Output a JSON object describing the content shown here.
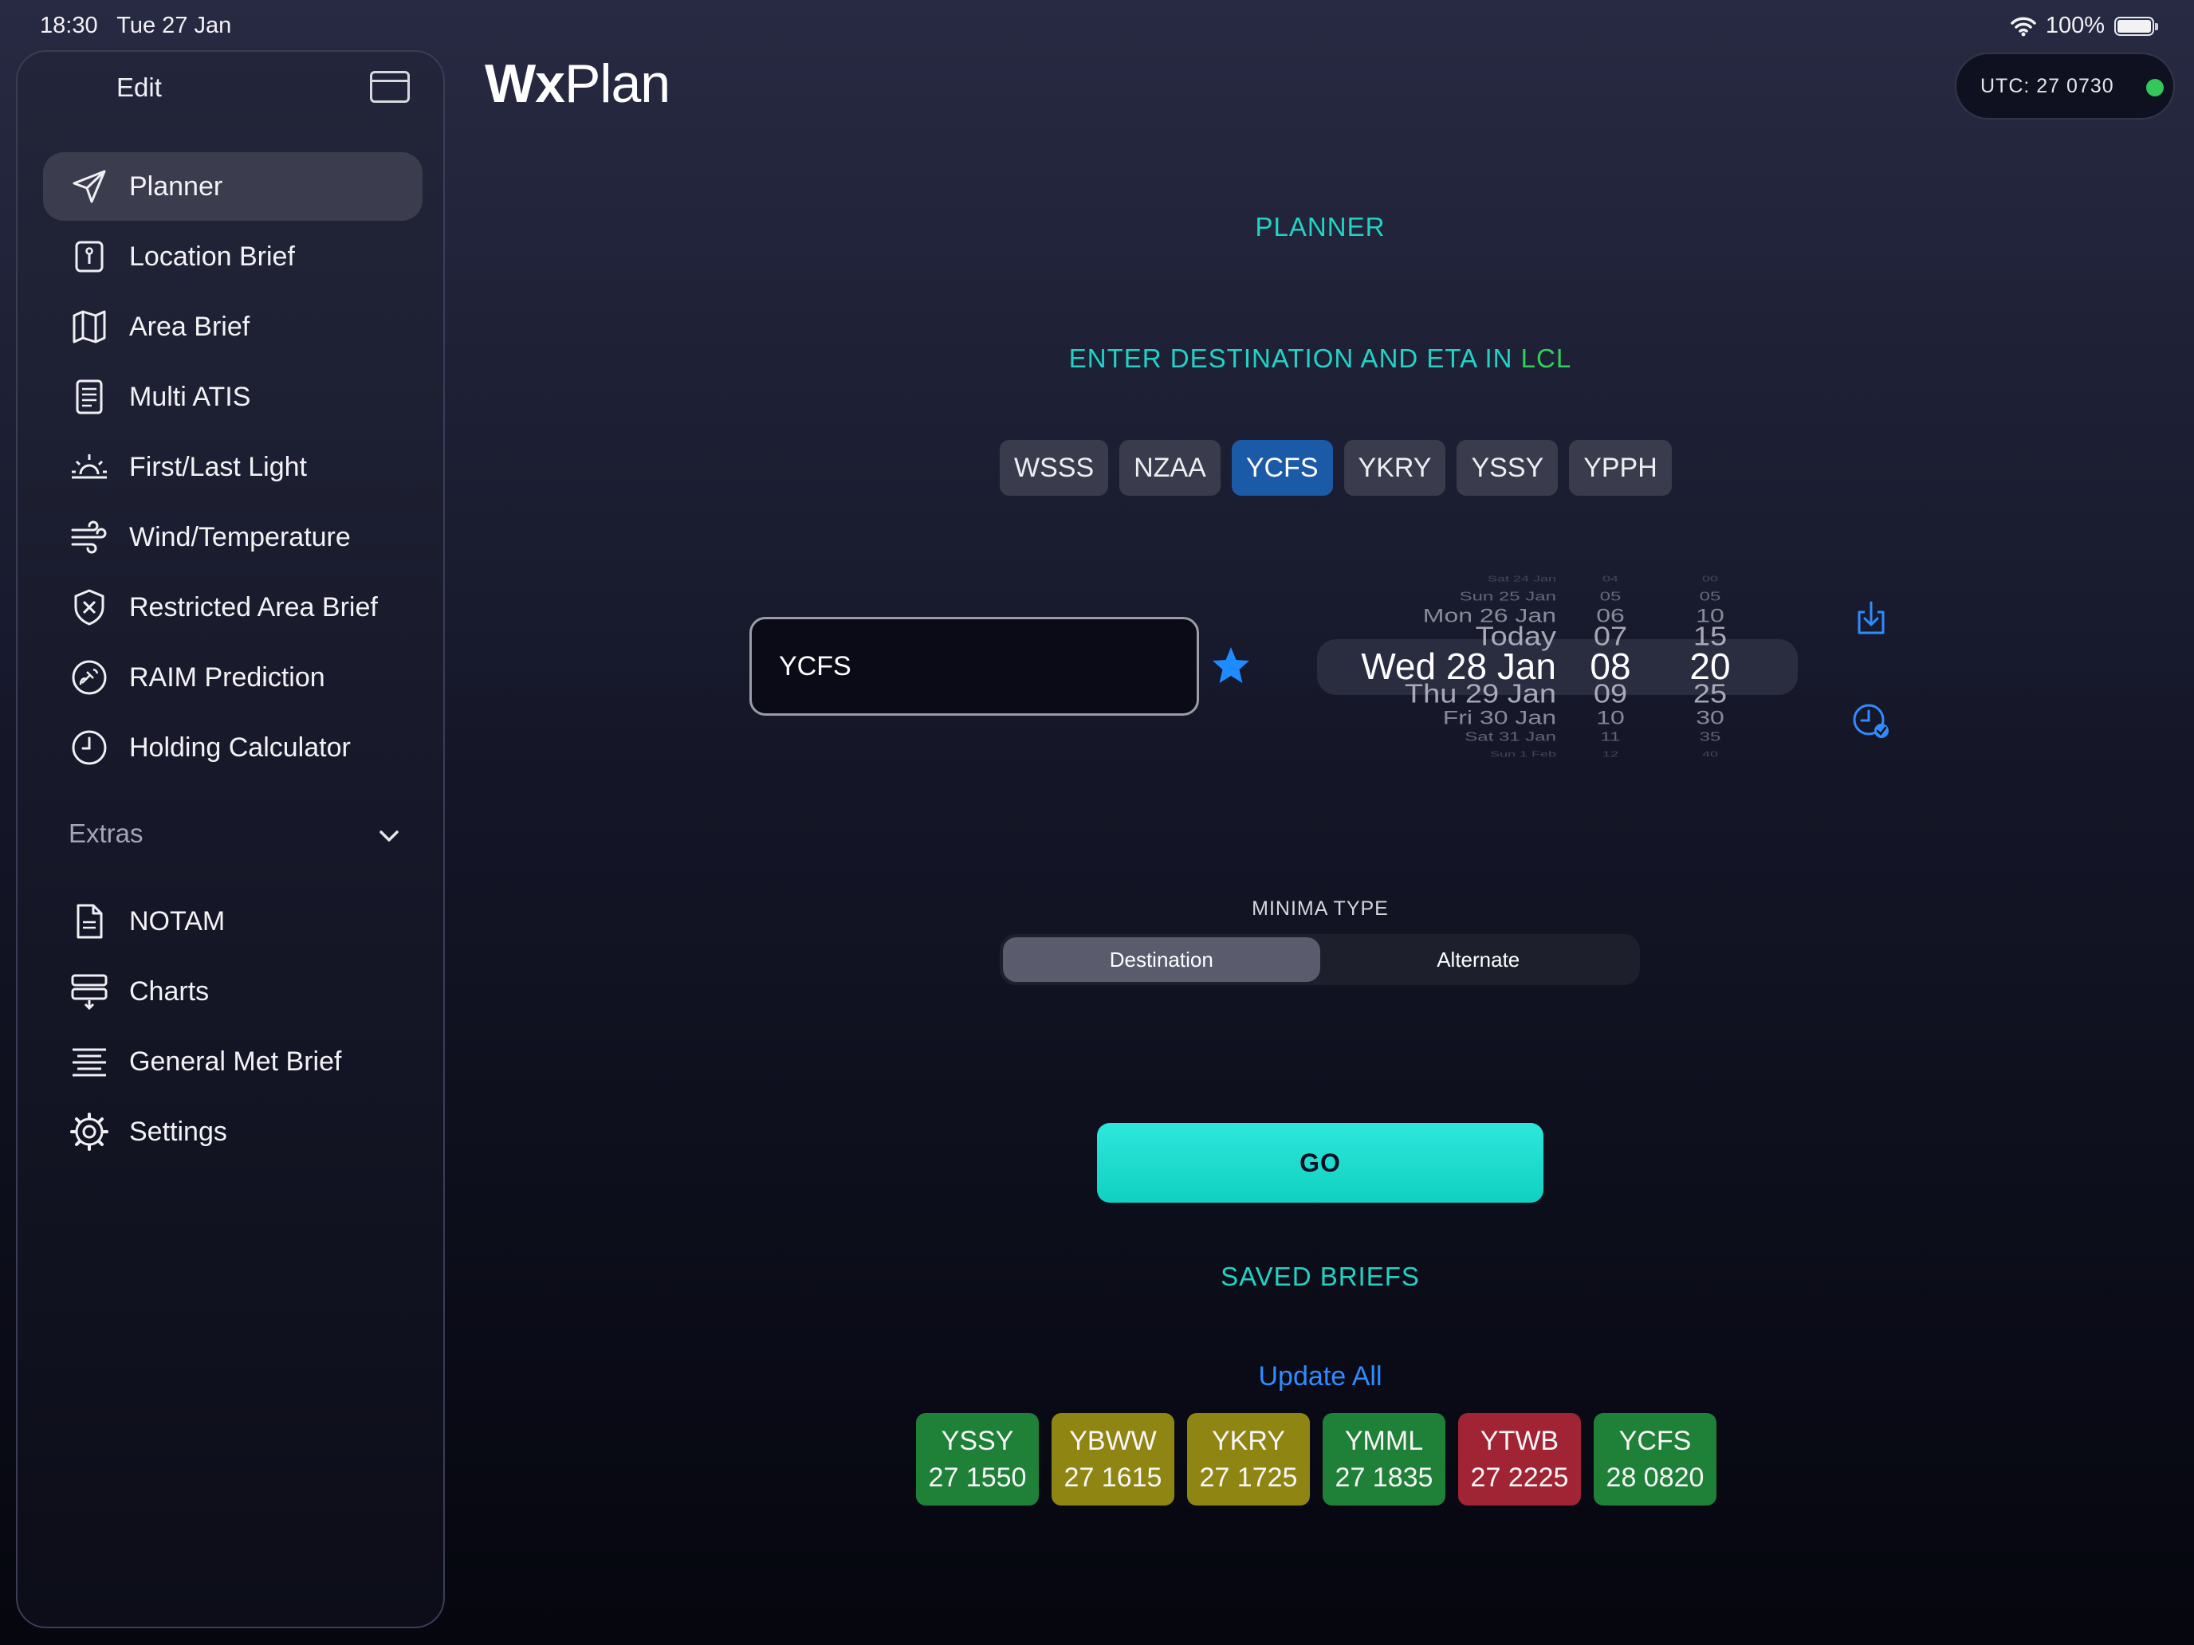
{
  "status_bar": {
    "time": "18:30",
    "date": "Tue 27 Jan",
    "battery": "100%"
  },
  "sidebar": {
    "edit_label": "Edit",
    "items": [
      {
        "label": "Planner",
        "icon": "paper-plane-icon",
        "active": true
      },
      {
        "label": "Location Brief",
        "icon": "location-brief-icon"
      },
      {
        "label": "Area Brief",
        "icon": "map-icon"
      },
      {
        "label": "Multi ATIS",
        "icon": "list-document-icon"
      },
      {
        "label": "First/Last Light",
        "icon": "sunrise-icon"
      },
      {
        "label": "Wind/Temperature",
        "icon": "wind-icon"
      },
      {
        "label": "Restricted Area Brief",
        "icon": "shield-x-icon"
      },
      {
        "label": "RAIM Prediction",
        "icon": "satellite-icon"
      },
      {
        "label": "Holding Calculator",
        "icon": "clock-icon"
      }
    ],
    "extras_label": "Extras",
    "extras_items": [
      {
        "label": "NOTAM",
        "icon": "document-icon"
      },
      {
        "label": "Charts",
        "icon": "charts-icon"
      },
      {
        "label": "General Met Brief",
        "icon": "met-lines-icon"
      },
      {
        "label": "Settings",
        "icon": "gear-icon"
      }
    ]
  },
  "header": {
    "title_bold": "Wx",
    "title_light": "Plan",
    "utc_label": "UTC:",
    "utc_value": "27 0730",
    "utc_status_color": "#34c759"
  },
  "planner": {
    "heading": "PLANNER",
    "instruction_main": "ENTER DESTINATION AND ETA IN",
    "instruction_unit": "LCL",
    "quick_picks": [
      "WSSS",
      "NZAA",
      "YCFS",
      "YKRY",
      "YSSY",
      "YPPH"
    ],
    "selected_quick_pick": "YCFS",
    "destination_value": "YCFS",
    "picker": {
      "dates": [
        "Sat 24 Jan",
        "Sun 25 Jan",
        "Mon 26 Jan",
        "Today",
        "Wed 28 Jan",
        "Thu 29 Jan",
        "Fri 30 Jan",
        "Sat 31 Jan",
        "Sun 1 Feb"
      ],
      "hours": [
        "04",
        "05",
        "06",
        "07",
        "08",
        "09",
        "10",
        "11",
        "12"
      ],
      "minutes": [
        "00",
        "05",
        "10",
        "15",
        "20",
        "25",
        "30",
        "35",
        "40"
      ],
      "selected_index": 4
    },
    "minima_label": "MINIMA TYPE",
    "minima_options": [
      "Destination",
      "Alternate"
    ],
    "minima_selected": "Destination",
    "go_label": "GO",
    "saved_heading": "SAVED BRIEFS",
    "update_all": "Update All",
    "saved_briefs": [
      {
        "station": "YSSY",
        "time": "27 1550",
        "status": "green"
      },
      {
        "station": "YBWW",
        "time": "27 1615",
        "status": "amber"
      },
      {
        "station": "YKRY",
        "time": "27 1725",
        "status": "amber"
      },
      {
        "station": "YMML",
        "time": "27 1835",
        "status": "green"
      },
      {
        "station": "YTWB",
        "time": "27 2225",
        "status": "red"
      },
      {
        "station": "YCFS",
        "time": "28 0820",
        "status": "green"
      }
    ]
  },
  "colors": {
    "accent_teal": "#22d3c5",
    "accent_blue": "#2f8cff",
    "status_green": "#1f8038",
    "status_amber": "#8f8513",
    "status_red": "#a02433"
  }
}
